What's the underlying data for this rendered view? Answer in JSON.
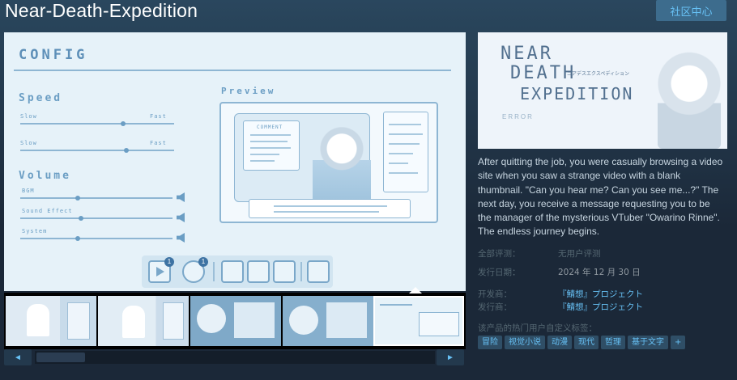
{
  "game": {
    "title": "Near-Death-Expedition",
    "community_button": "社区中心"
  },
  "screenshot_ui": {
    "config_title": "CONFIG",
    "speed_label": "Speed",
    "slow_label": "Slow",
    "fast_label": "Fast",
    "volume_label": "Volume",
    "bgm_label": "BGM",
    "sound_effect_label": "Sound Effect",
    "system_label": "System",
    "preview_label": "Preview",
    "comment_label": "COMMENT",
    "badge_count": "1"
  },
  "header_capsule": {
    "logo_text_line1": "NEAR",
    "logo_text_line2": "DEATH",
    "logo_text_line3": "EXPEDITION",
    "logo_subtext": "ニアデスエクスペディション",
    "error_text": "ERROR"
  },
  "description": "After quitting the job, you were casually browsing a video site when you saw a strange video with a blank thumbnail. \"Can you hear me? Can you see me...?\" The next day, you receive a message requesting you to be the manager of the mysterious VTuber \"Owarino Rinne\". The endless journey begins.",
  "meta": {
    "reviews_label": "全部评测：",
    "reviews_value": "无用户评测",
    "release_label": "发行日期：",
    "release_value": "2024 年 12 月 30 日",
    "developer_label": "开发商：",
    "developer_value": "『鯖想』プロジェクト",
    "publisher_label": "发行商：",
    "publisher_value": "『鯖想』プロジェクト"
  },
  "tags": {
    "label": "该产品的热门用户自定义标签：",
    "items": [
      "冒险",
      "视觉小说",
      "动漫",
      "现代",
      "哲理",
      "基于文字",
      "+"
    ]
  },
  "scroll": {
    "left_arrow": "◄",
    "right_arrow": "►"
  },
  "colors": {
    "background": "#1b2838",
    "link": "#67c1f5",
    "button_bg": "#3d6c8d",
    "tag_bg": "#2f4e66"
  }
}
